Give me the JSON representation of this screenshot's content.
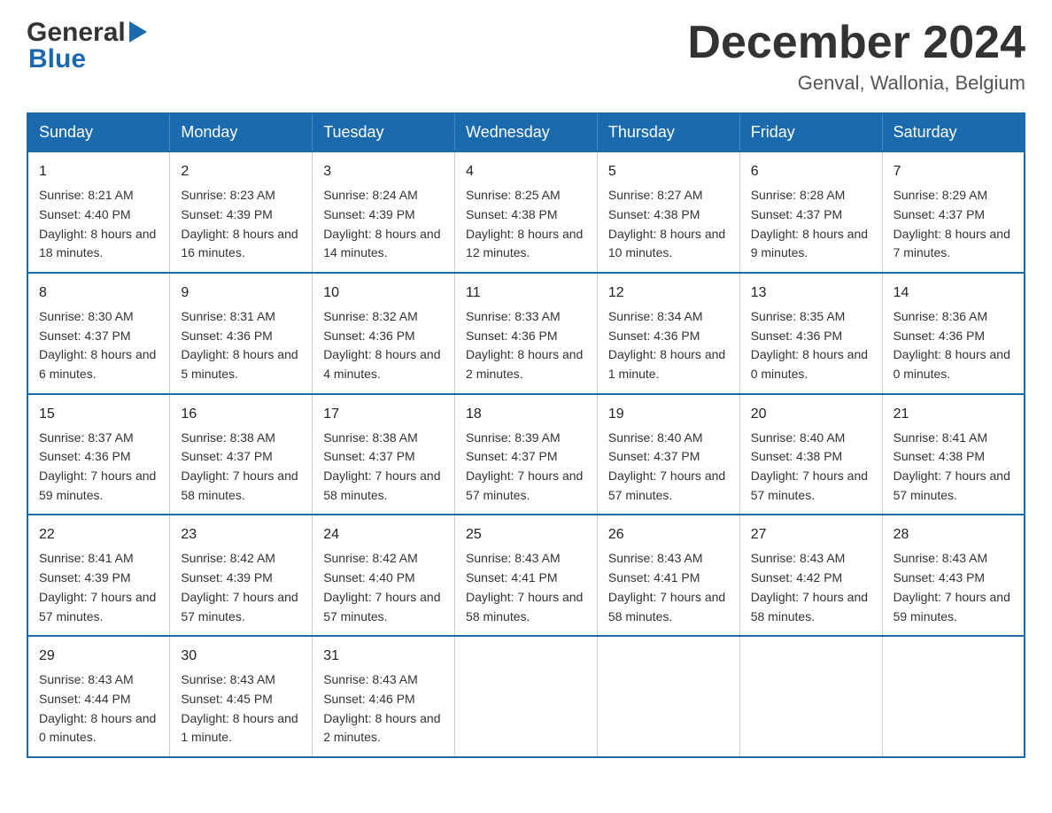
{
  "header": {
    "logo_general": "General",
    "logo_blue": "Blue",
    "month_title": "December 2024",
    "subtitle": "Genval, Wallonia, Belgium"
  },
  "columns": [
    "Sunday",
    "Monday",
    "Tuesday",
    "Wednesday",
    "Thursday",
    "Friday",
    "Saturday"
  ],
  "weeks": [
    [
      {
        "day": "1",
        "sunrise": "8:21 AM",
        "sunset": "4:40 PM",
        "daylight": "8 hours and 18 minutes."
      },
      {
        "day": "2",
        "sunrise": "8:23 AM",
        "sunset": "4:39 PM",
        "daylight": "8 hours and 16 minutes."
      },
      {
        "day": "3",
        "sunrise": "8:24 AM",
        "sunset": "4:39 PM",
        "daylight": "8 hours and 14 minutes."
      },
      {
        "day": "4",
        "sunrise": "8:25 AM",
        "sunset": "4:38 PM",
        "daylight": "8 hours and 12 minutes."
      },
      {
        "day": "5",
        "sunrise": "8:27 AM",
        "sunset": "4:38 PM",
        "daylight": "8 hours and 10 minutes."
      },
      {
        "day": "6",
        "sunrise": "8:28 AM",
        "sunset": "4:37 PM",
        "daylight": "8 hours and 9 minutes."
      },
      {
        "day": "7",
        "sunrise": "8:29 AM",
        "sunset": "4:37 PM",
        "daylight": "8 hours and 7 minutes."
      }
    ],
    [
      {
        "day": "8",
        "sunrise": "8:30 AM",
        "sunset": "4:37 PM",
        "daylight": "8 hours and 6 minutes."
      },
      {
        "day": "9",
        "sunrise": "8:31 AM",
        "sunset": "4:36 PM",
        "daylight": "8 hours and 5 minutes."
      },
      {
        "day": "10",
        "sunrise": "8:32 AM",
        "sunset": "4:36 PM",
        "daylight": "8 hours and 4 minutes."
      },
      {
        "day": "11",
        "sunrise": "8:33 AM",
        "sunset": "4:36 PM",
        "daylight": "8 hours and 2 minutes."
      },
      {
        "day": "12",
        "sunrise": "8:34 AM",
        "sunset": "4:36 PM",
        "daylight": "8 hours and 1 minute."
      },
      {
        "day": "13",
        "sunrise": "8:35 AM",
        "sunset": "4:36 PM",
        "daylight": "8 hours and 0 minutes."
      },
      {
        "day": "14",
        "sunrise": "8:36 AM",
        "sunset": "4:36 PM",
        "daylight": "8 hours and 0 minutes."
      }
    ],
    [
      {
        "day": "15",
        "sunrise": "8:37 AM",
        "sunset": "4:36 PM",
        "daylight": "7 hours and 59 minutes."
      },
      {
        "day": "16",
        "sunrise": "8:38 AM",
        "sunset": "4:37 PM",
        "daylight": "7 hours and 58 minutes."
      },
      {
        "day": "17",
        "sunrise": "8:38 AM",
        "sunset": "4:37 PM",
        "daylight": "7 hours and 58 minutes."
      },
      {
        "day": "18",
        "sunrise": "8:39 AM",
        "sunset": "4:37 PM",
        "daylight": "7 hours and 57 minutes."
      },
      {
        "day": "19",
        "sunrise": "8:40 AM",
        "sunset": "4:37 PM",
        "daylight": "7 hours and 57 minutes."
      },
      {
        "day": "20",
        "sunrise": "8:40 AM",
        "sunset": "4:38 PM",
        "daylight": "7 hours and 57 minutes."
      },
      {
        "day": "21",
        "sunrise": "8:41 AM",
        "sunset": "4:38 PM",
        "daylight": "7 hours and 57 minutes."
      }
    ],
    [
      {
        "day": "22",
        "sunrise": "8:41 AM",
        "sunset": "4:39 PM",
        "daylight": "7 hours and 57 minutes."
      },
      {
        "day": "23",
        "sunrise": "8:42 AM",
        "sunset": "4:39 PM",
        "daylight": "7 hours and 57 minutes."
      },
      {
        "day": "24",
        "sunrise": "8:42 AM",
        "sunset": "4:40 PM",
        "daylight": "7 hours and 57 minutes."
      },
      {
        "day": "25",
        "sunrise": "8:43 AM",
        "sunset": "4:41 PM",
        "daylight": "7 hours and 58 minutes."
      },
      {
        "day": "26",
        "sunrise": "8:43 AM",
        "sunset": "4:41 PM",
        "daylight": "7 hours and 58 minutes."
      },
      {
        "day": "27",
        "sunrise": "8:43 AM",
        "sunset": "4:42 PM",
        "daylight": "7 hours and 58 minutes."
      },
      {
        "day": "28",
        "sunrise": "8:43 AM",
        "sunset": "4:43 PM",
        "daylight": "7 hours and 59 minutes."
      }
    ],
    [
      {
        "day": "29",
        "sunrise": "8:43 AM",
        "sunset": "4:44 PM",
        "daylight": "8 hours and 0 minutes."
      },
      {
        "day": "30",
        "sunrise": "8:43 AM",
        "sunset": "4:45 PM",
        "daylight": "8 hours and 1 minute."
      },
      {
        "day": "31",
        "sunrise": "8:43 AM",
        "sunset": "4:46 PM",
        "daylight": "8 hours and 2 minutes."
      },
      null,
      null,
      null,
      null
    ]
  ],
  "sunrise_label": "Sunrise:",
  "sunset_label": "Sunset:",
  "daylight_label": "Daylight:"
}
